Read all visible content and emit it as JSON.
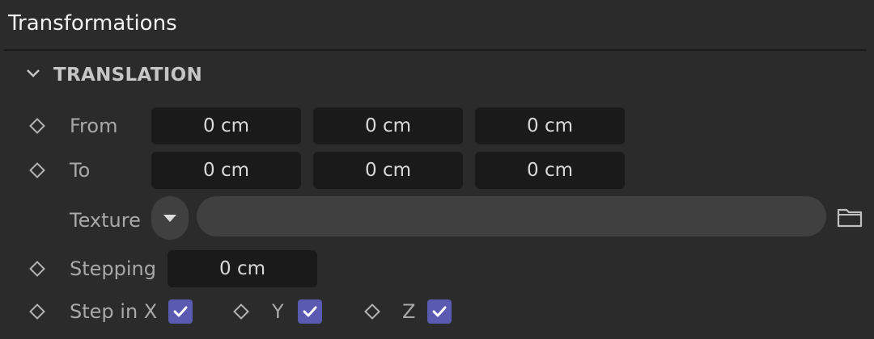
{
  "panel": {
    "title": "Transformations"
  },
  "section": {
    "label": "TRANSLATION",
    "collapse_icon": "chevron-down-icon"
  },
  "from": {
    "label": "From",
    "x": "0 cm",
    "y": "0 cm",
    "z": "0 cm"
  },
  "to": {
    "label": "To",
    "x": "0 cm",
    "y": "0 cm",
    "z": "0 cm"
  },
  "texture": {
    "label": "Texture",
    "value": "",
    "browse_icon": "folder-icon",
    "dropdown_icon": "caret-down-icon"
  },
  "stepping": {
    "label": "Stepping",
    "value": "0 cm"
  },
  "step": {
    "x_label": "Step in X",
    "x_checked": true,
    "y_label": "Y",
    "y_checked": true,
    "z_label": "Z",
    "z_checked": true
  },
  "colors": {
    "background": "#2b2b2b",
    "field": "#1a1a1a",
    "checkbox": "#5a5ab0"
  }
}
